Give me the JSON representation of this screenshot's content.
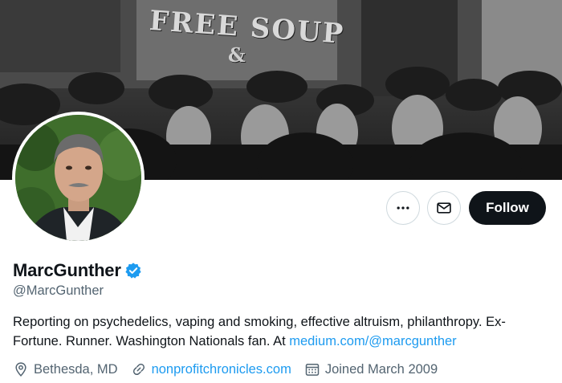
{
  "banner": {
    "sign_text": "FREE SOUP",
    "sign_amp": "&"
  },
  "profile": {
    "display_name": "MarcGunther",
    "handle": "@MarcGunther",
    "verified": true,
    "bio_text": "Reporting on psychedelics, vaping and smoking, effective altruism, philanthropy. Ex-Fortune. Runner. Washington Nationals fan. At ",
    "bio_link": "medium.com/@marcgunther",
    "location": "Bethesda, MD",
    "website": "nonprofitchronicles.com",
    "joined": "Joined March 2009"
  },
  "actions": {
    "more_icon": "more-horizontal-icon",
    "message_icon": "envelope-icon",
    "follow_label": "Follow"
  },
  "colors": {
    "accent": "#1d9bf0",
    "primary_text": "#0f1419",
    "secondary_text": "#536471",
    "follow_bg": "#0f1419",
    "border": "#cfd9de"
  }
}
